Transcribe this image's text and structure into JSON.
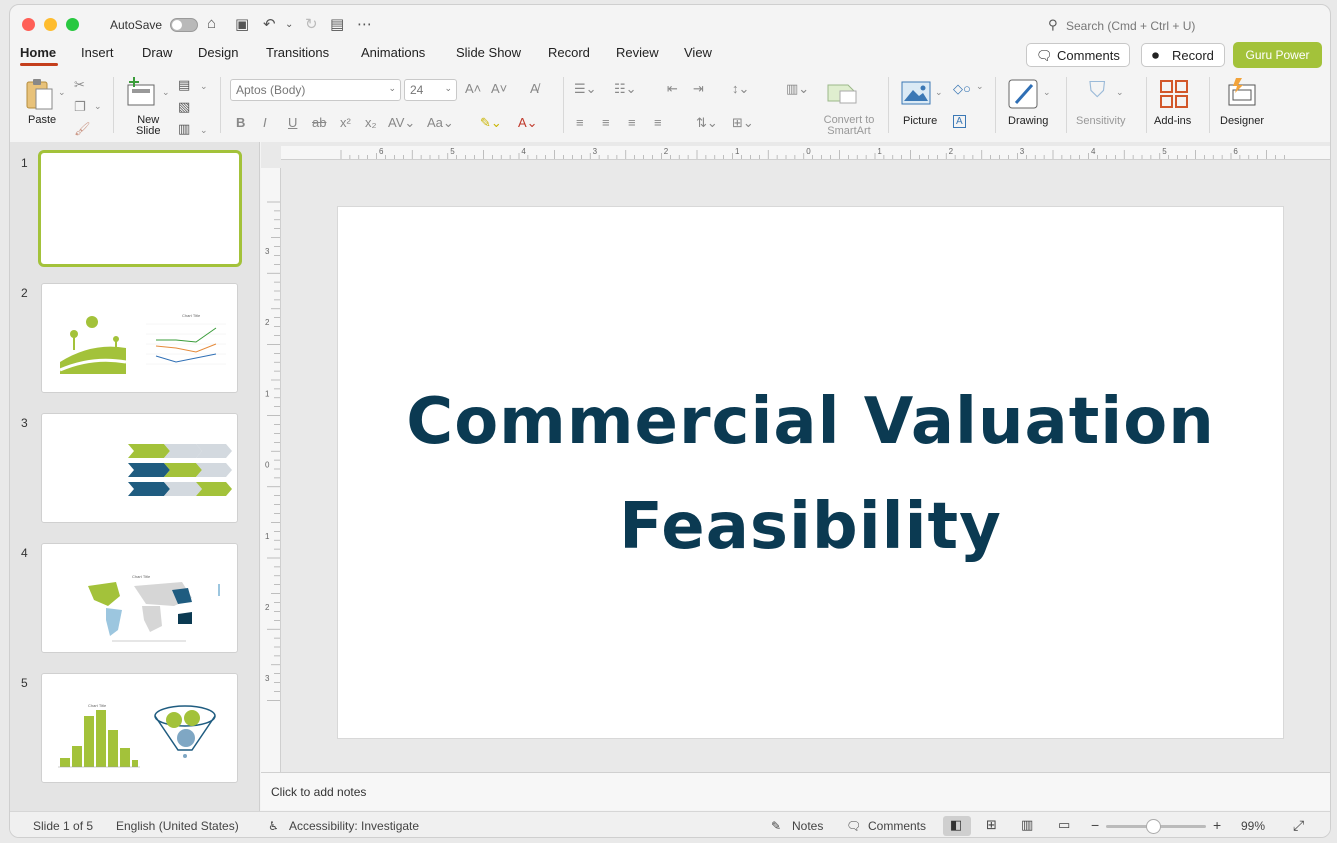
{
  "titlebar": {
    "autosave_label": "AutoSave",
    "search_placeholder": "Search (Cmd + Ctrl + U)"
  },
  "tabs": [
    "Home",
    "Insert",
    "Draw",
    "Design",
    "Transitions",
    "Animations",
    "Slide Show",
    "Record",
    "Review",
    "View"
  ],
  "header_buttons": {
    "comments": "Comments",
    "record": "Record",
    "guru": "Guru Power"
  },
  "ribbon": {
    "paste": "Paste",
    "new_slide_1": "New",
    "new_slide_2": "Slide",
    "font_name": "Aptos (Body)",
    "font_size": "24",
    "convert_1": "Convert to",
    "convert_2": "SmartArt",
    "picture": "Picture",
    "drawing": "Drawing",
    "sensitivity": "Sensitivity",
    "addins": "Add-ins",
    "designer": "Designer"
  },
  "thumbnails": [
    "1",
    "2",
    "3",
    "4",
    "5"
  ],
  "thumb_texts": {
    "chart_title": "Chart Title"
  },
  "slide": {
    "title_line1": "Commercial Valuation",
    "title_line2": "Feasibility"
  },
  "notes_placeholder": "Click to add notes",
  "status": {
    "slide_of": "Slide 1 of 5",
    "language": "English (United States)",
    "accessibility": "Accessibility: Investigate",
    "notes": "Notes",
    "comments": "Comments",
    "zoom": "99%"
  },
  "ruler": {
    "h_ticks": [
      "6",
      "5",
      "4",
      "3",
      "2",
      "1",
      "0",
      "1",
      "2",
      "3",
      "4",
      "5",
      "6"
    ],
    "v_ticks": [
      "3",
      "2",
      "1",
      "0",
      "1",
      "2",
      "3"
    ]
  },
  "colors": {
    "accent_green": "#a3c23a",
    "title_navy": "#0b3a52",
    "tab_underline": "#c43e1c"
  }
}
